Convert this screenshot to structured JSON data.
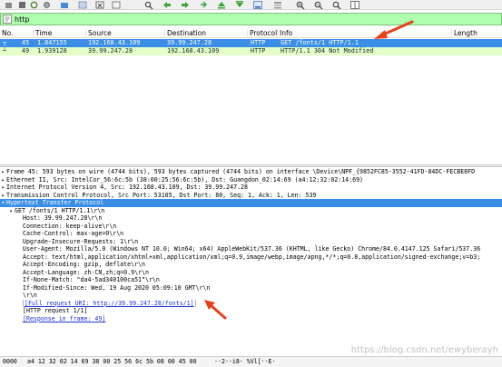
{
  "filter": {
    "value": "http"
  },
  "columns": [
    "No.",
    "Time",
    "Source",
    "Destination",
    "Protocol",
    "Info",
    "Length"
  ],
  "packets": [
    {
      "no": "45",
      "time": "1.847155",
      "source": "192.168.43.109",
      "destination": "39.99.247.28",
      "protocol": "HTTP",
      "info": "GET /fonts/1 HTTP/1.1"
    },
    {
      "no": "49",
      "time": "1.939128",
      "source": "39.99.247.28",
      "destination": "192.168.43.109",
      "protocol": "HTTP",
      "info": "HTTP/1.1 304 Not Modified"
    }
  ],
  "details": [
    {
      "toggle": "▸",
      "text": "Frame 45: 593 bytes on wire (4744 bits), 593 bytes captured (4744 bits) on interface \\Device\\NPF_{9852FC85-3552-41FD-84DC-FECBE8FD"
    },
    {
      "toggle": "▸",
      "text": "Ethernet II, Src: IntelCor_56:6c:5b (38:00:25:56:6c:5b), Dst: Guangdon_02:14:69 (a4:12:32:02:14:69)"
    },
    {
      "toggle": "▸",
      "text": "Internet Protocol Version 4, Src: 192.168.43.109, Dst: 39.99.247.28"
    },
    {
      "toggle": "▸",
      "text": "Transmission Control Protocol, Src Port: 53105, Dst Port: 80, Seq: 1, Ack: 1, Len: 539"
    },
    {
      "toggle": "▾",
      "text": "Hypertext Transfer Protocol"
    },
    {
      "toggle": "▸",
      "text": "GET /fonts/1 HTTP/1.1\\r\\n"
    },
    {
      "toggle": "",
      "text": "Host: 39.99.247.28\\r\\n"
    },
    {
      "toggle": "",
      "text": "Connection: keep-alive\\r\\n"
    },
    {
      "toggle": "",
      "text": "Cache-Control: max-age=0\\r\\n"
    },
    {
      "toggle": "",
      "text": "Upgrade-Insecure-Requests: 1\\r\\n"
    },
    {
      "toggle": "",
      "text": "User-Agent: Mozilla/5.0 (Windows NT 10.0; Win64; x64) AppleWebKit/537.36 (KHTML, like Gecko) Chrome/84.0.4147.125 Safari/537.36"
    },
    {
      "toggle": "",
      "text": "Accept: text/html,application/xhtml+xml,application/xml;q=0.9,image/webp,image/apng,*/*;q=0.8,application/signed-exchange;v=b3;"
    },
    {
      "toggle": "",
      "text": "Accept-Encoding: gzip, deflate\\r\\n"
    },
    {
      "toggle": "",
      "text": "Accept-Language: zh-CN,zh;q=0.9\\r\\n"
    },
    {
      "toggle": "",
      "text": "If-None-Match: \"da4-5ad340100ca51\"\\r\\n"
    },
    {
      "toggle": "",
      "text": "If-Modified-Since: Wed, 19 Aug 2020 05:09:10 GMT\\r\\n"
    },
    {
      "toggle": "",
      "text": "\\r\\n"
    },
    {
      "toggle": "",
      "text": "[Full request URI: http://39.99.247.28/fonts/1]"
    },
    {
      "toggle": "",
      "text": "[HTTP request 1/1]"
    },
    {
      "toggle": "",
      "text": "[Response in frame: 49]"
    }
  ],
  "bytes": {
    "offset": "0000",
    "hex": "a4 12 32 02 14 69 38 00  25 56 6c 5b 08 00 45 00",
    "ascii": "··2··i8·  %Vl[··E·"
  },
  "watermark": "https://blog.csdn.net/ewyberayh",
  "colors": {
    "selected": "#3a8ee6",
    "http_row": "#e4ffc7",
    "filter_ok": "#afffaf",
    "annotation": "#e8401c"
  }
}
